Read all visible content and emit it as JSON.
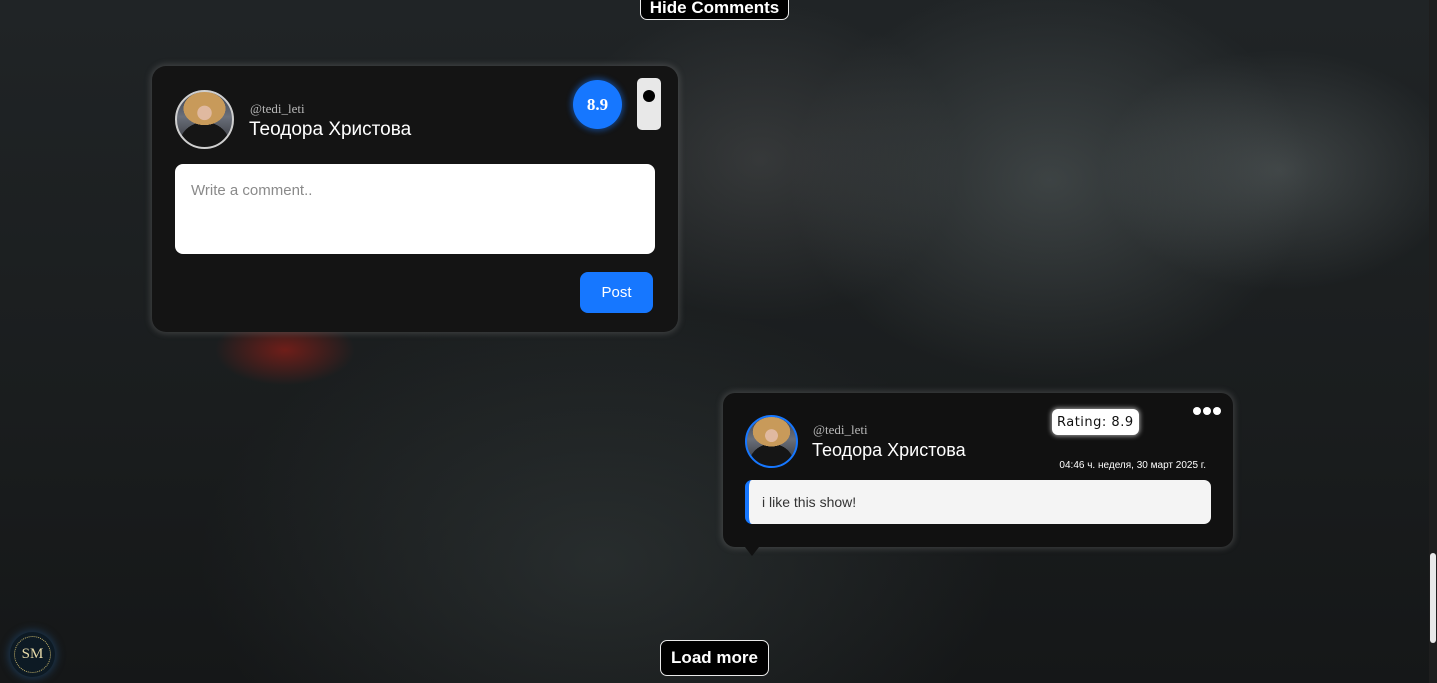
{
  "actions": {
    "hide_comments_label": "Hide Comments",
    "load_more_label": "Load more"
  },
  "compose": {
    "username": "@tedi_leti",
    "fullname": "Теодора Христова",
    "score": "8.9",
    "comment_placeholder": "Write a comment..",
    "post_label": "Post"
  },
  "comments": [
    {
      "username": "@tedi_leti",
      "fullname": "Теодора Христова",
      "rating": "Rating: 8.9",
      "timestamp": "04:46 ч. неделя, 30 март 2025 г.",
      "text": "i like this show!"
    }
  ],
  "logo": {
    "text": "SM"
  },
  "colors": {
    "accent": "#1677ff",
    "card_background": "#141414",
    "button_background": "#000000"
  },
  "icons": {
    "more_menu": "more-horizontal-icon",
    "avatar": "user-avatar"
  }
}
